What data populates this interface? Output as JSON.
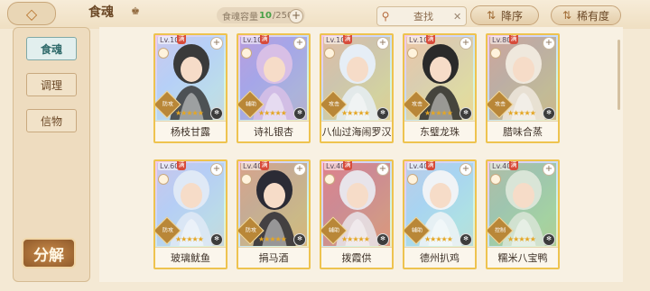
{
  "header": {
    "title": "食魂",
    "capacity": {
      "label": "食魂容量",
      "current": "10",
      "total": "/250"
    },
    "search_placeholder": "查找",
    "sort_label": "降序",
    "rarity_label": "稀有度"
  },
  "sidebar": {
    "tabs": [
      {
        "label": "食魂",
        "active": true
      },
      {
        "label": "调理",
        "active": false
      },
      {
        "label": "信物",
        "active": false
      }
    ],
    "decompose_label": "分解"
  },
  "cards": [
    {
      "level": "Lv.100",
      "name": "杨枝甘露",
      "role": "防攻",
      "stars": 5,
      "hair": "#3a3a3a",
      "bg": "#a9c9f1"
    },
    {
      "level": "Lv.100",
      "name": "诗礼银杏",
      "role": "辅助",
      "stars": 5,
      "hair": "#d8bfe6",
      "bg": "#8b7bd6"
    },
    {
      "level": "Lv.100",
      "name": "八仙过海闹罗汉",
      "role": "攻击",
      "stars": 5,
      "hair": "#e6eef6",
      "bg": "#d4b46a"
    },
    {
      "level": "Lv.100",
      "name": "东璧龙珠",
      "role": "攻击",
      "stars": 5,
      "hair": "#2a2a2a",
      "bg": "#e9c56f"
    },
    {
      "level": "Lv.80",
      "name": "腊味合蒸",
      "role": "攻击",
      "stars": 5,
      "hair": "#efe8dd",
      "bg": "#b58b5a"
    },
    {
      "level": "Lv.60",
      "name": "玻璃鱿鱼",
      "role": "防攻",
      "stars": 5,
      "hair": "#dfe9f6",
      "bg": "#a8c4ec"
    },
    {
      "level": "Lv.40",
      "name": "捐马酒",
      "role": "防攻",
      "stars": 5,
      "hair": "#2b2b35",
      "bg": "#c4873c"
    },
    {
      "level": "Lv.40",
      "name": "拨霞供",
      "role": "辅助",
      "stars": 5,
      "hair": "#e8e4ea",
      "bg": "#d24a3c"
    },
    {
      "level": "Lv.40",
      "name": "德州扒鸡",
      "role": "辅助",
      "stars": 5,
      "hair": "#f0f3f6",
      "bg": "#8fd0e6"
    },
    {
      "level": "Lv.40",
      "name": "糯米八宝鸭",
      "role": "控制",
      "stars": 5,
      "hair": "#d9e5d7",
      "bg": "#7db56e"
    }
  ],
  "colors": {
    "full_badge": "#d74b3a",
    "capacity_current": "#47a046"
  },
  "icons": {
    "back": "back-arrow-icon",
    "search": "search-icon",
    "sort": "sort-icon",
    "rarity": "rarity-icon"
  }
}
